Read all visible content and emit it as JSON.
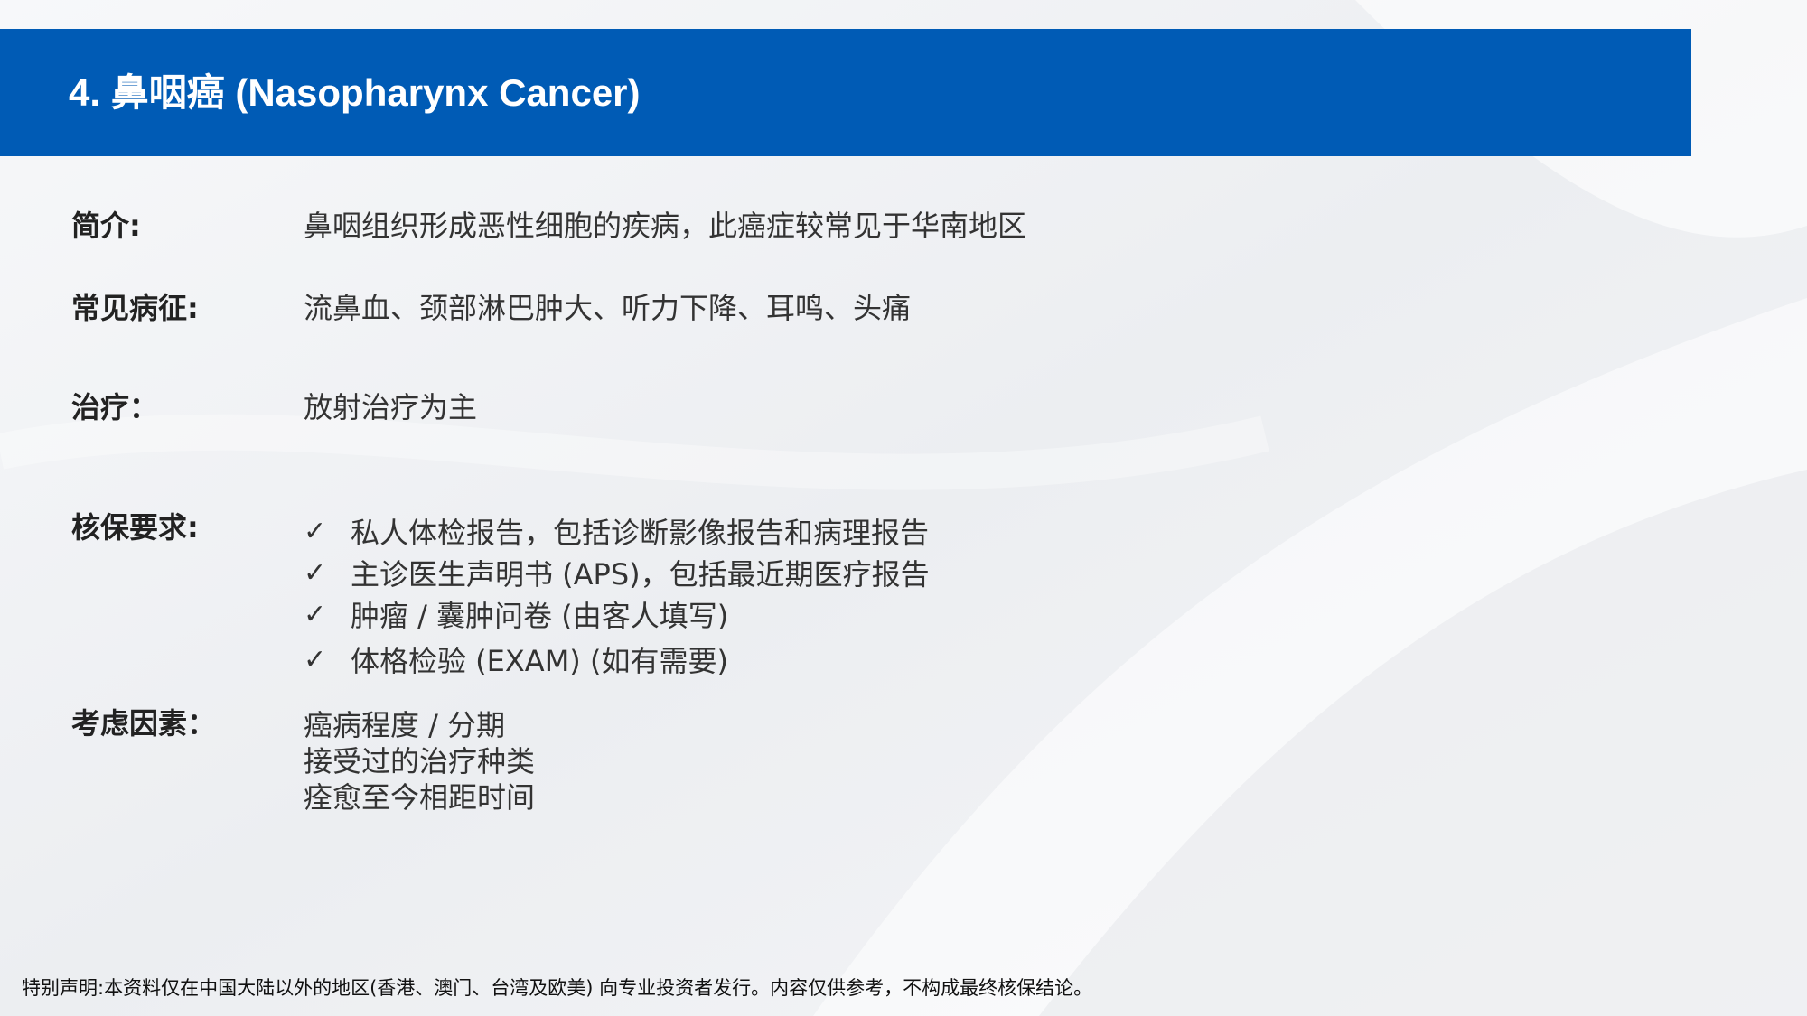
{
  "slide": {
    "title": "4. 鼻咽癌 (Nasopharynx Cancer)"
  },
  "sections": {
    "intro": {
      "label": "简介:",
      "value": "鼻咽组织形成恶性细胞的疾病，此癌症较常见于华南地区"
    },
    "symptoms": {
      "label": "常见病征:",
      "value": "流鼻血、颈部淋巴肿大、听力下降、耳鸣、头痛"
    },
    "treatment": {
      "label": "治疗：",
      "value": "放射治疗为主"
    },
    "underwriting": {
      "label": "核保要求:",
      "check_icon": "check-icon",
      "items": [
        "私人体检报告，包括诊断影像报告和病理报告",
        "主诊医生声明书 (APS)，包括最近期医疗报告",
        "肿瘤 / 囊肿问卷 (由客人填写)",
        "体格检验 (EXAM) (如有需要)"
      ]
    },
    "factors": {
      "label": "考虑因素：",
      "items": [
        "癌病程度 / 分期",
        "接受过的治疗种类",
        "痊愈至今相距时间"
      ]
    }
  },
  "footer": {
    "disclaimer": "特别声明:本资料仅在中国大陆以外的地区(香港、澳门、台湾及欧美) 向专业投资者发行。内容仅供参考，不构成最终核保结论。"
  },
  "colors": {
    "header_blue": "#005bb5",
    "background": "#f4f5f7"
  }
}
